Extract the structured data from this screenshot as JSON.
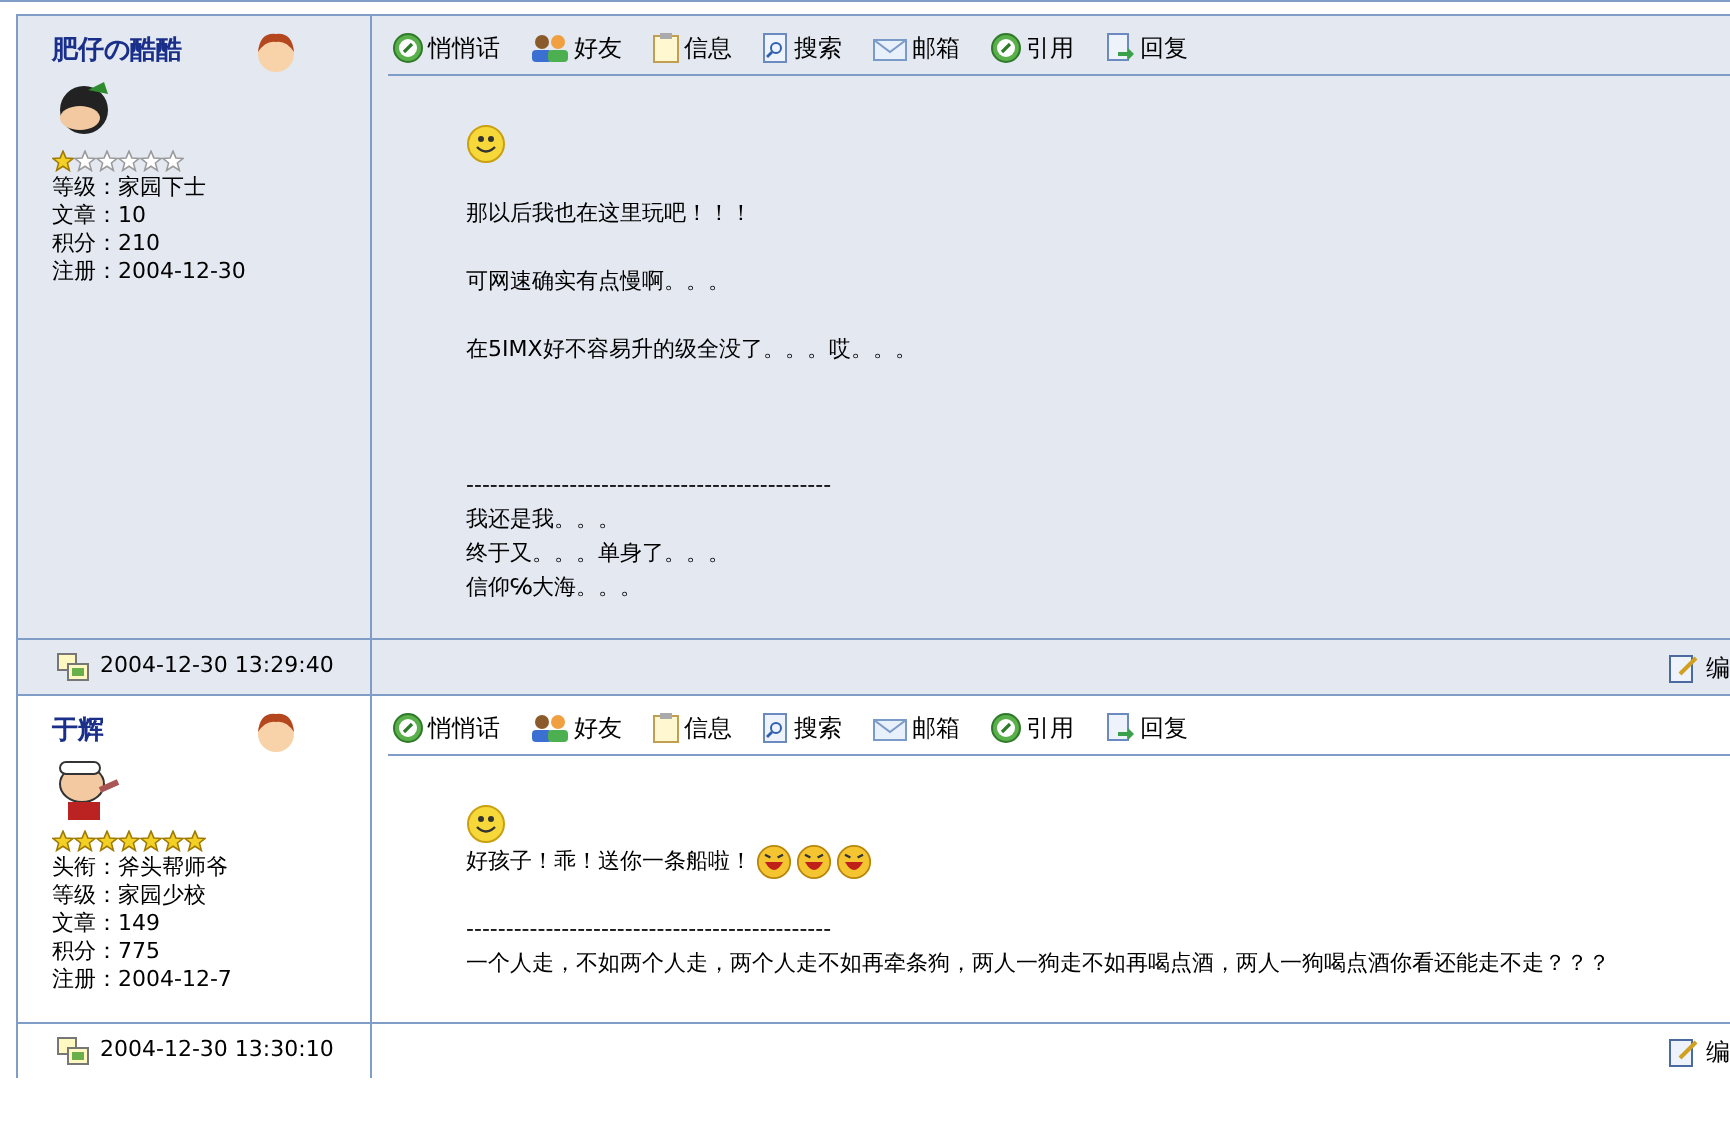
{
  "posts": [
    {
      "author": {
        "name": "肥仔の酷酷",
        "rank_stars": [
          {
            "filled": true
          },
          {
            "filled": false
          },
          {
            "filled": false
          },
          {
            "filled": false
          },
          {
            "filled": false
          },
          {
            "filled": false
          }
        ],
        "details": [
          "等级：家园下士",
          "文章：10",
          "积分：210",
          "注册：2004-12-30"
        ]
      },
      "actions": [
        "悄悄话",
        "好友",
        "信息",
        "搜索",
        "邮箱",
        "引用",
        "回复"
      ],
      "body": [
        {
          "kind": "emoticon"
        },
        {
          "kind": "gap"
        },
        {
          "kind": "text",
          "text": "那以后我也在这里玩吧！！！"
        },
        {
          "kind": "gap"
        },
        {
          "kind": "text",
          "text": "可网速确实有点慢啊。。。"
        },
        {
          "kind": "gap"
        },
        {
          "kind": "text",
          "text": "在5IMX好不容易升的级全没了。。。哎。。。"
        },
        {
          "kind": "gap"
        },
        {
          "kind": "gap"
        },
        {
          "kind": "gap"
        },
        {
          "kind": "text",
          "text": "----------------------------------------------"
        },
        {
          "kind": "text",
          "text": "我还是我。。。"
        },
        {
          "kind": "text",
          "text": "终于又。。。单身了。。。"
        },
        {
          "kind": "text",
          "text": "信仰℅大海。。。"
        }
      ],
      "posted_at": "2004-12-30 13:29:40",
      "edit_label": "编"
    },
    {
      "author": {
        "name": "于辉",
        "rank_stars": [
          {
            "filled": true
          },
          {
            "filled": true
          },
          {
            "filled": true
          },
          {
            "filled": true
          },
          {
            "filled": true
          },
          {
            "filled": true
          },
          {
            "filled": true
          }
        ],
        "details": [
          "头衔：斧头帮师爷",
          "等级：家园少校",
          "文章：149",
          "积分：775",
          "注册：2004-12-7"
        ]
      },
      "actions": [
        "悄悄话",
        "好友",
        "信息",
        "搜索",
        "邮箱",
        "引用",
        "回复"
      ],
      "body": [
        {
          "kind": "emoticon"
        },
        {
          "kind": "text",
          "text": "好孩子！乖！送你一条船啦！",
          "emoticons": [
            {
              "kind": "laugh"
            },
            {
              "kind": "laugh"
            },
            {
              "kind": "laugh"
            }
          ]
        },
        {
          "kind": "gap"
        },
        {
          "kind": "text",
          "text": "----------------------------------------------"
        },
        {
          "kind": "text",
          "text": "一个人走，不如两个人走，两个人走不如再牵条狗，两人一狗走不如再喝点酒，两人一狗喝点酒你看还能走不走？？？"
        }
      ],
      "posted_at": "2004-12-30 13:30:10",
      "edit_label": "编"
    }
  ]
}
